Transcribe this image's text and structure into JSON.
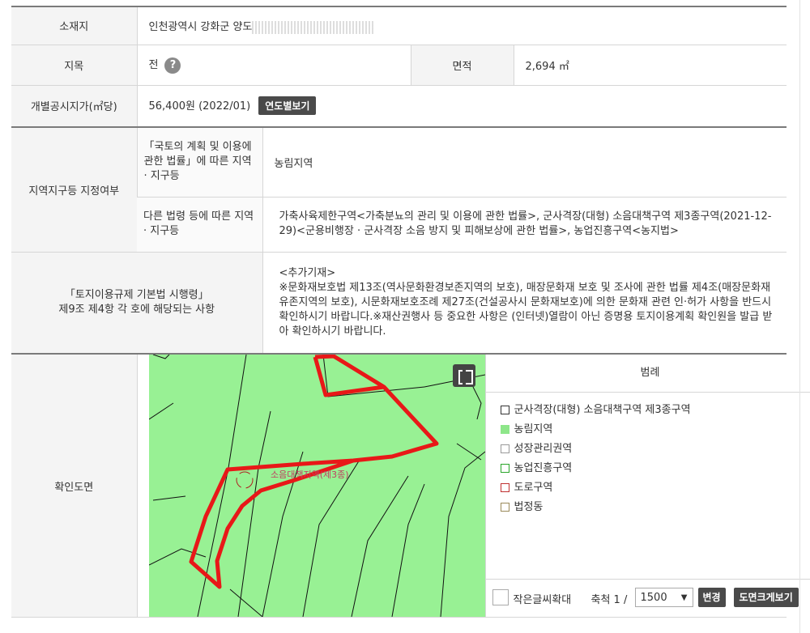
{
  "location": {
    "label": "소재지",
    "value": "인천광역시 강화군 양도"
  },
  "category": {
    "label": "지목",
    "value": "전",
    "help_icon": "?",
    "area_label": "면적",
    "area_value": "2,694 ㎡"
  },
  "price": {
    "label": "개별공시지가(㎡당)",
    "value": "56,400원 (2022/01)",
    "button": "연도별보기"
  },
  "zoning": {
    "label": "지역지구등 지정여부",
    "sub1_label": "「국토의 계획 및 이용에 관한 법률」에 따른 지역 · 지구등",
    "sub1_value": "농림지역",
    "sub2_label": "다른 법령 등에 따른 지역 · 지구등",
    "sub2_value": "가축사육제한구역<가축분뇨의 관리 및 이용에 관한 법률>, 군사격장(대형) 소음대책구역 제3종구역(2021-12-29)<군용비행장 · 군사격장 소음 방지 및 피해보상에 관한 법률>, 농업진흥구역<농지법>"
  },
  "regulation": {
    "label_line1": "「토지이용규제 기본법 시행령」",
    "label_line2": "제9조 제4항 각 호에 해당되는 사항",
    "value_title": "<추가기재>",
    "value_body": "※문화재보호법 제13조(역사문화환경보존지역의 보호), 매장문화재 보호 및 조사에 관한 법률 제4조(매장문화재 유존지역의 보호), 시문화재보호조례 제27조(건설공사시 문화재보호)에 의한 문화재 관련 인·허가 사항을 반드시 확인하시기 바랍니다.※재산권행사 등 중요한 사항은 (인터넷)열람이 아닌 증명용 토지이용계획 확인원을 발급 받아 확인하시기 바랍니다."
  },
  "map": {
    "label": "확인도면",
    "map_annotation": "소음대책지역(제3종)",
    "legend_title": "범례",
    "legend_items": [
      {
        "label": "군사격장(대형) 소음대책구역 제3종구역",
        "fill": "#ffffff",
        "border": "#333333"
      },
      {
        "label": "농림지역",
        "fill": "#8ee68a",
        "border": "#8ee68a"
      },
      {
        "label": "성장관리권역",
        "fill": "#ffffff",
        "border": "#999999"
      },
      {
        "label": "농업진흥구역",
        "fill": "#ffffff",
        "border": "#2aa52a"
      },
      {
        "label": "도로구역",
        "fill": "#ffffff",
        "border": "#c03030"
      },
      {
        "label": "법정동",
        "fill": "#ffffff",
        "border": "#9a8a5a"
      }
    ],
    "small_text_label": "작은글씨확대",
    "scale_label": "축척 1 /",
    "scale_value": "1500",
    "change_button": "변경",
    "enlarge_button": "도면크게보기",
    "colors": {
      "map_green": "#98f194",
      "parcel_red": "#e81818"
    }
  }
}
